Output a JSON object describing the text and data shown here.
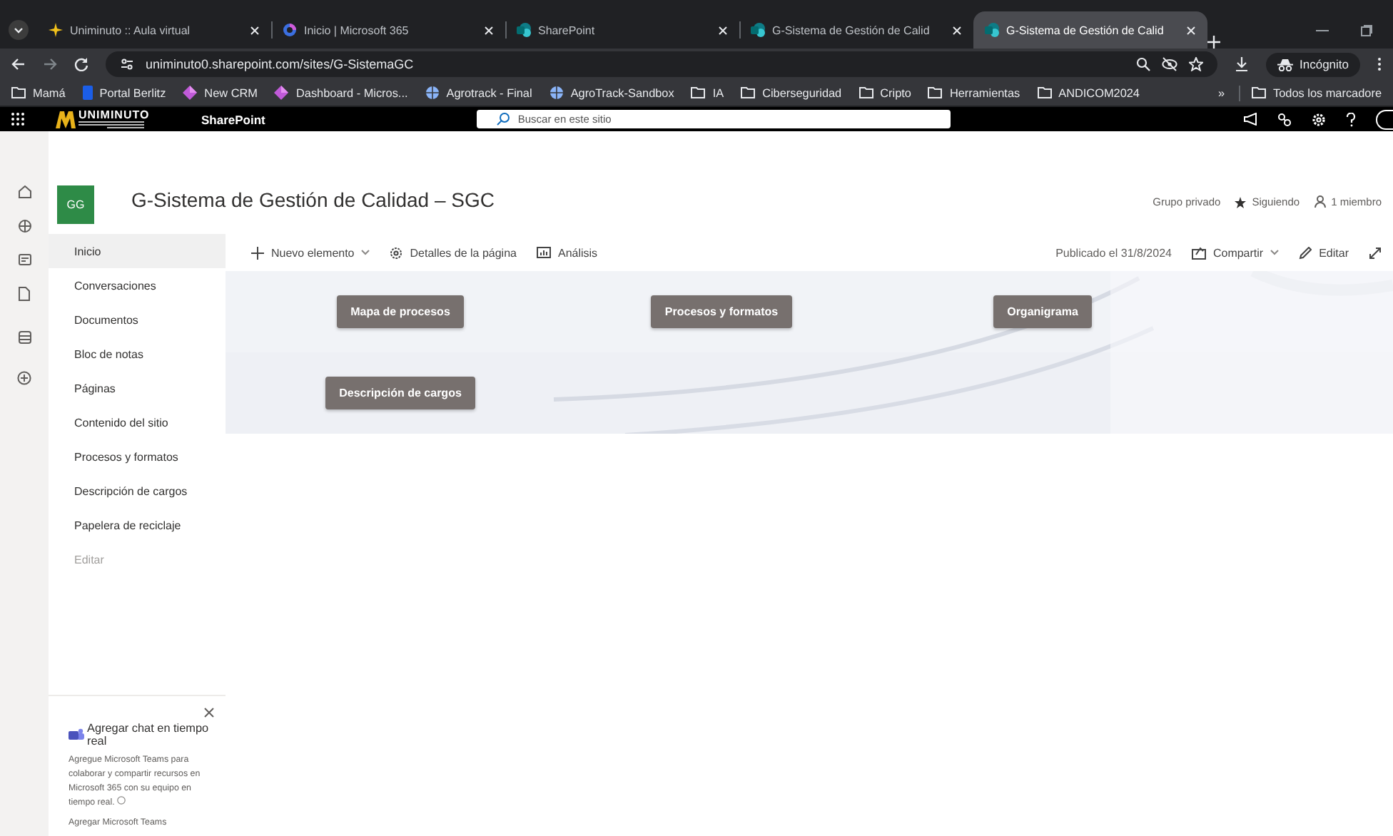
{
  "browser": {
    "tabs": [
      {
        "title": "Uniminuto :: Aula virtual",
        "kind": "star",
        "selected": false
      },
      {
        "title": "Inicio | Microsoft 365",
        "kind": "ring",
        "selected": false
      },
      {
        "title": "SharePoint",
        "kind": "circles",
        "selected": false
      },
      {
        "title": "G-Sistema de Gestión de Calid",
        "kind": "circles",
        "selected": false
      },
      {
        "title": "G-Sistema de Gestión de Calid",
        "kind": "circles",
        "selected": true
      }
    ],
    "url": "uniminuto0.sharepoint.com/sites/G-SistemaGC",
    "profile": "Incógnito",
    "bookmarks": [
      {
        "label": "Mamá",
        "kind": "folder"
      },
      {
        "label": "Portal Berlitz",
        "kind": "berlitz"
      },
      {
        "label": "New CRM",
        "kind": "diamond"
      },
      {
        "label": "Dashboard - Micros...",
        "kind": "diamond"
      },
      {
        "label": "Agrotrack - Final",
        "kind": "globe"
      },
      {
        "label": "AgroTrack-Sandbox",
        "kind": "globe"
      },
      {
        "label": "IA",
        "kind": "folder"
      },
      {
        "label": "Ciberseguridad",
        "kind": "folder"
      },
      {
        "label": "Cripto",
        "kind": "folder"
      },
      {
        "label": "Herramientas",
        "kind": "folder"
      },
      {
        "label": "ANDICOM2024",
        "kind": "folder"
      }
    ],
    "bookmarks_more": "»",
    "all_bookmarks": "Todos los marcadore"
  },
  "suite_bar": {
    "logo": {
      "name": "UNIMINUTO"
    },
    "app": "SharePoint",
    "search": {
      "placeholder": "Buscar en este sitio"
    }
  },
  "site": {
    "initials": "GG",
    "title": "G-Sistema de Gestión de Calidad – SGC",
    "privacy": "Grupo privado",
    "follow": "Siguiendo",
    "members": "1 miembro"
  },
  "nav": [
    {
      "label": "Inicio",
      "kind": "link",
      "selected": true
    },
    {
      "label": "Conversaciones",
      "kind": "link",
      "selected": false
    },
    {
      "label": "Documentos",
      "kind": "link",
      "selected": false
    },
    {
      "label": "Bloc de notas",
      "kind": "link",
      "selected": false
    },
    {
      "label": "Páginas",
      "kind": "link",
      "selected": false
    },
    {
      "label": "Contenido del sitio",
      "kind": "link",
      "selected": false
    },
    {
      "label": "Procesos y formatos",
      "kind": "link",
      "selected": false
    },
    {
      "label": "Descripción de cargos",
      "kind": "link",
      "selected": false
    },
    {
      "label": "Papelera de reciclaje",
      "kind": "link",
      "selected": false
    },
    {
      "label": "Editar",
      "kind": "edit",
      "selected": false
    }
  ],
  "teams_panel": {
    "title": "Agregar chat en tiempo real",
    "body": "Agregue Microsoft Teams para colaborar y compartir recursos en Microsoft 365 con su equipo en tiempo real.",
    "link": "Agregar Microsoft Teams"
  },
  "command_bar": {
    "left": [
      {
        "label": "Nuevo elemento",
        "kind": "new"
      },
      {
        "label": "Detalles de la página",
        "kind": "details"
      },
      {
        "label": "Análisis",
        "kind": "analytics"
      }
    ],
    "published": "Publicado el 31/8/2024",
    "right": [
      {
        "label": "Compartir",
        "kind": "share"
      },
      {
        "label": "Editar",
        "kind": "edit"
      }
    ]
  },
  "hero": {
    "rows": [
      [
        "Mapa de procesos",
        "Procesos y formatos",
        "Organigrama"
      ],
      [
        "Descripción de cargos"
      ]
    ]
  }
}
